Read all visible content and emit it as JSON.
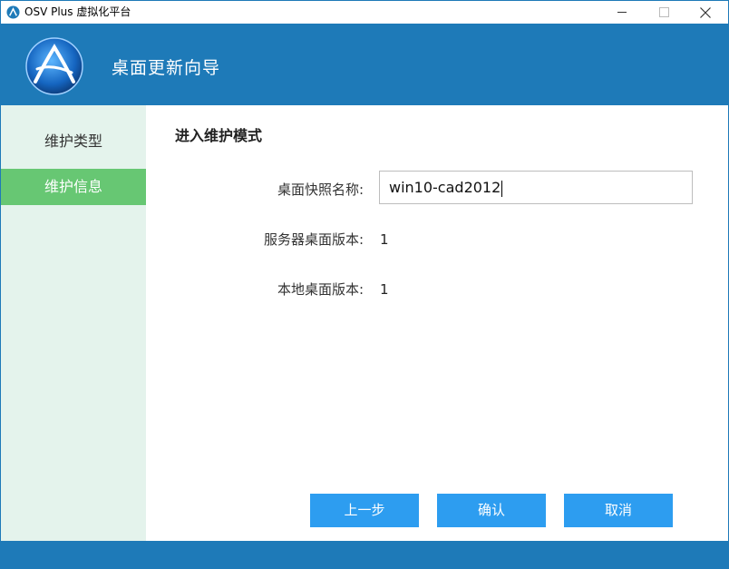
{
  "window": {
    "title": "OSV Plus 虚拟化平台",
    "icons": {
      "app": "app-logo-icon",
      "minimize": "minimize-icon",
      "maximize": "maximize-icon",
      "close": "close-icon"
    },
    "colors": {
      "header": "#1e7ab8",
      "sidebar": "#e4f3ec",
      "active": "#67c773",
      "button": "#2d9df0"
    }
  },
  "header": {
    "title": "桌面更新向导",
    "logo_icon": "osv-logo-icon"
  },
  "sidebar": {
    "items": [
      {
        "label": "维护类型",
        "active": false
      },
      {
        "label": "维护信息",
        "active": true
      }
    ]
  },
  "main": {
    "section_title": "进入维护模式",
    "snapshot_name": {
      "label": "桌面快照名称:",
      "value": "win10-cad2012"
    },
    "server_version": {
      "label": "服务器桌面版本:",
      "value": "1"
    },
    "local_version": {
      "label": "本地桌面版本:",
      "value": "1"
    }
  },
  "buttons": {
    "prev": "上一步",
    "confirm": "确认",
    "cancel": "取消"
  }
}
